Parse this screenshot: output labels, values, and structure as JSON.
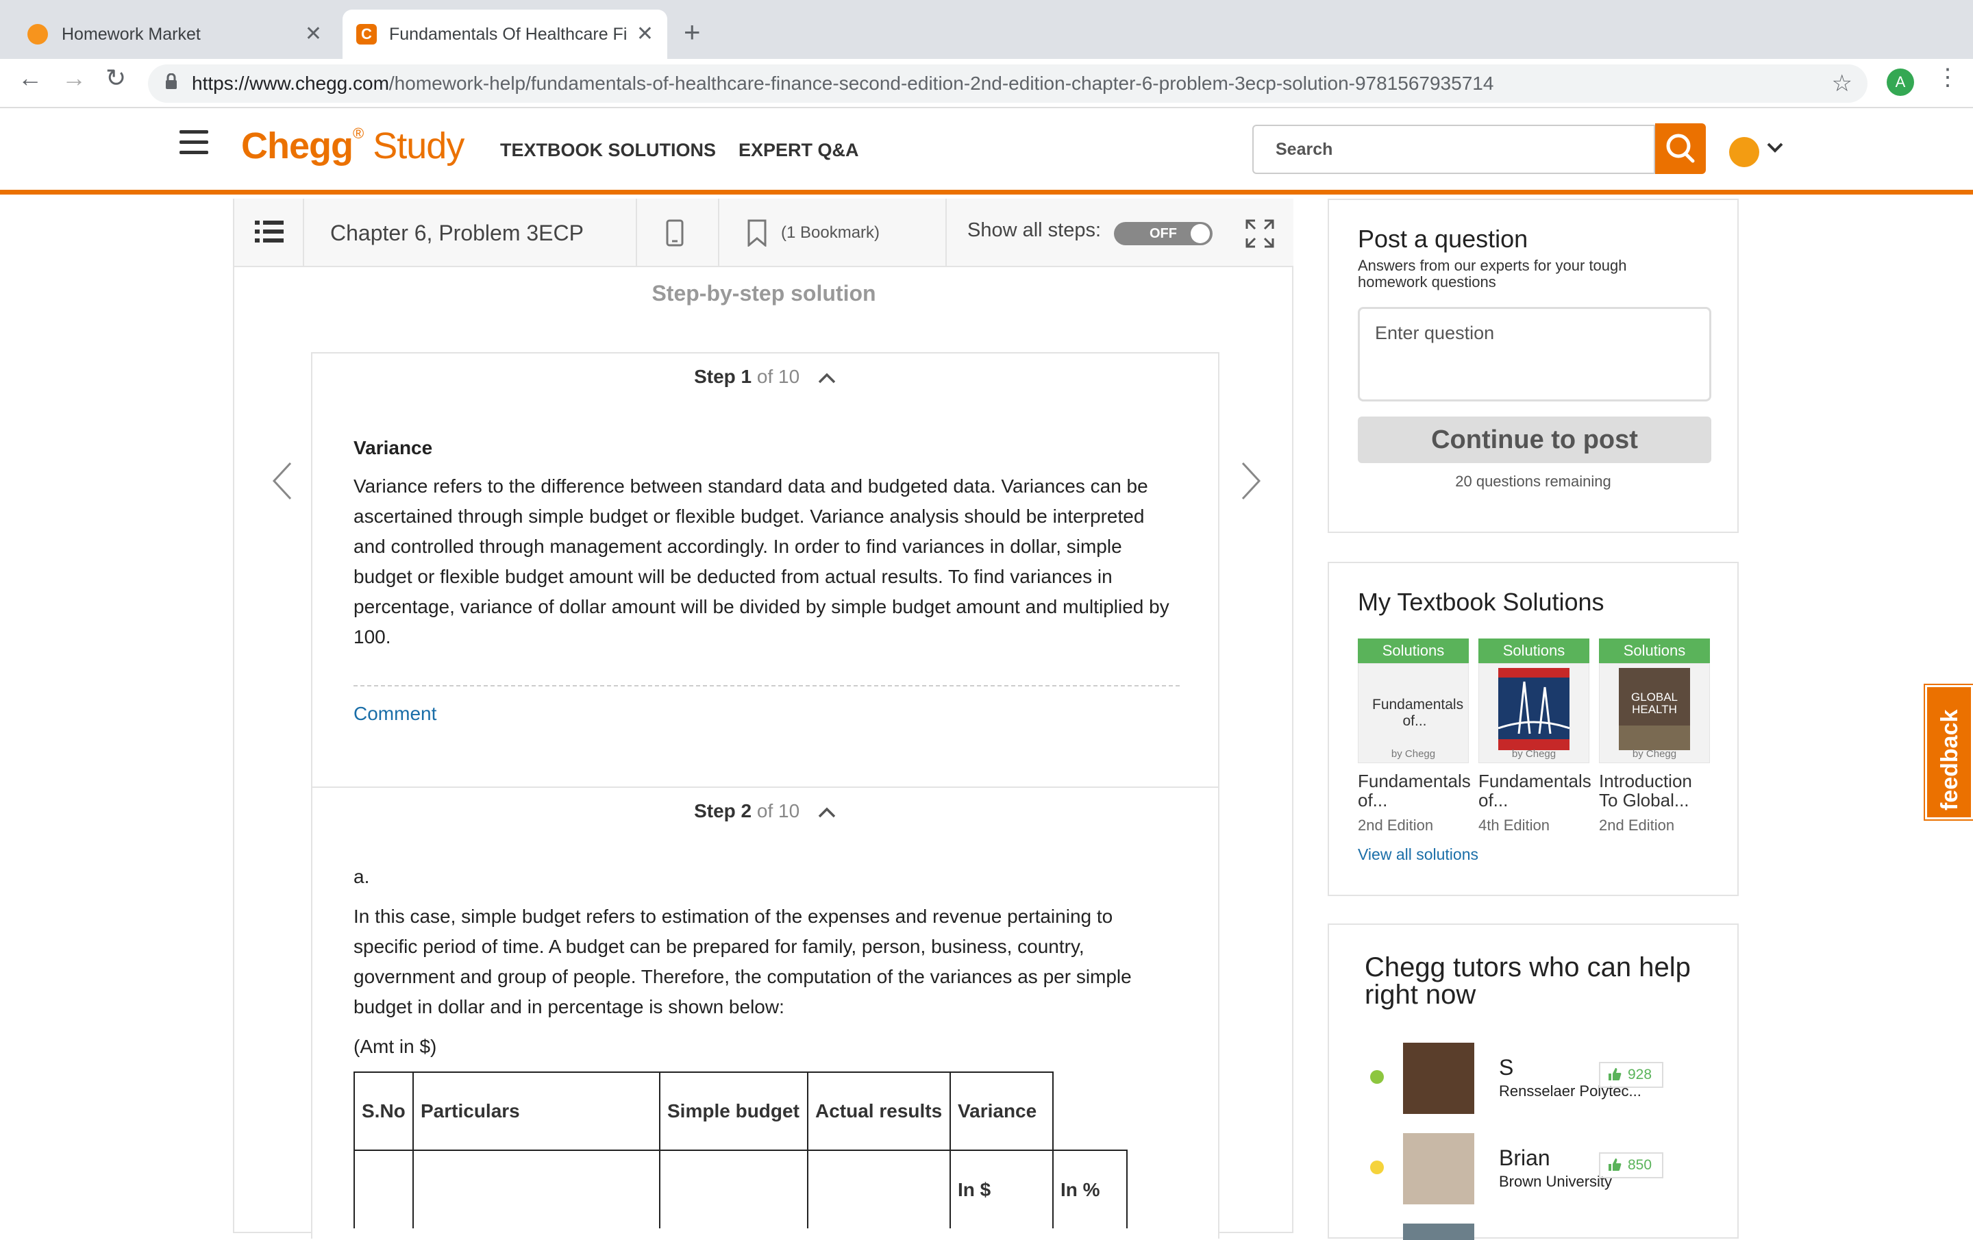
{
  "browser": {
    "tabs": [
      {
        "title": "Homework Market"
      },
      {
        "title": "Fundamentals Of Healthcare Fi"
      }
    ],
    "url_host": "https://www.chegg.com",
    "url_path": "/homework-help/fundamentals-of-healthcare-finance-second-edition-2nd-edition-chapter-6-problem-3ecp-solution-9781567935714",
    "profile_initial": "A"
  },
  "header": {
    "logo_brand": "Chegg",
    "logo_product": "Study",
    "nav": [
      "TEXTBOOK SOLUTIONS",
      "EXPERT Q&A"
    ],
    "search_placeholder": "Search"
  },
  "stepbar": {
    "title": "Chapter 6, Problem 3ECP",
    "bookmark": "(1 Bookmark)",
    "show_all_label": "Show all steps:",
    "toggle_state": "OFF"
  },
  "solution": {
    "heading": "Step-by-step solution",
    "step1": {
      "label": "Step 1",
      "of": "of 10",
      "title": "Variance",
      "text": "Variance refers to the difference between standard data and budgeted data. Variances can be ascertained through simple budget or flexible budget. Variance analysis should be interpreted and controlled through management accordingly. In order to find variances in dollar, simple budget or flexible budget amount will be deducted from actual results. To find variances in percentage, variance of dollar amount will be divided by simple budget amount and multiplied by 100.",
      "comment": "Comment"
    },
    "step2": {
      "label": "Step 2",
      "of": "of 10",
      "part": "a.",
      "text": "In this case, simple budget refers to estimation of the expenses and revenue pertaining to specific period of time. A budget can be prepared for family, person, business, country, government and group of people. Therefore, the computation of the variances as per simple budget in dollar and in percentage is shown below:",
      "amt": "(Amt in $)",
      "table_headers": [
        "S.No",
        "Particulars",
        "Simple budget",
        "Actual results",
        "Variance"
      ],
      "sub_headers": [
        "In $",
        "In %"
      ]
    }
  },
  "post_question": {
    "title": "Post a question",
    "subtitle": "Answers from our experts for your tough homework questions",
    "placeholder": "Enter question",
    "button": "Continue to post",
    "remaining": "20 questions remaining"
  },
  "textbooks": {
    "title": "My Textbook Solutions",
    "badge": "Solutions",
    "books": [
      {
        "title": "Fundamentals of...",
        "edition": "2nd Edition",
        "cover_text": "Fundamentals of..."
      },
      {
        "title": "Fundamentals of...",
        "edition": "4th Edition"
      },
      {
        "title": "Introduction To Global...",
        "edition": "2nd Edition",
        "cover_text": "GLOBAL HEALTH"
      }
    ],
    "byline": "by Chegg",
    "view_all": "View all solutions"
  },
  "tutors": {
    "title": "Chegg tutors who can help right now",
    "list": [
      {
        "name": "S",
        "school": "Rensselaer Polytec...",
        "likes": "928",
        "status_color": "#8dc63f"
      },
      {
        "name": "Brian",
        "school": "Brown University",
        "likes": "850",
        "status_color": "#f5d33b"
      }
    ]
  },
  "feedback": "feedback",
  "colors": {
    "brand": "#eb7100",
    "green": "#5ab35a",
    "link": "#1a6ea8"
  }
}
